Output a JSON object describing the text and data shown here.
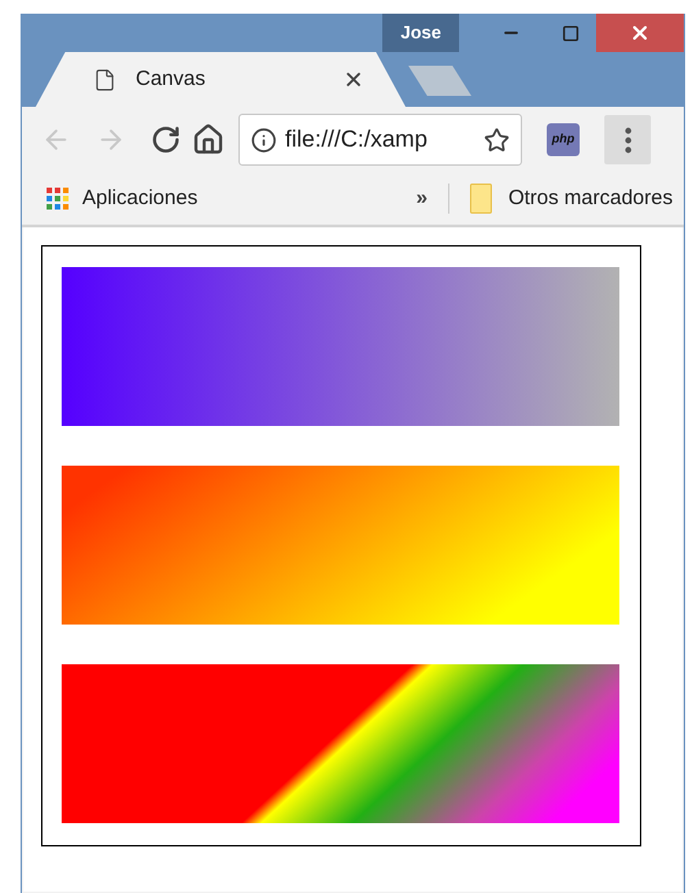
{
  "window": {
    "user": "Jose"
  },
  "tabs": [
    {
      "title": "Canvas",
      "selected": true
    }
  ],
  "toolbar": {
    "back_disabled": true,
    "forward_disabled": true,
    "url": "file:///C:/xamp",
    "extension": "php"
  },
  "bookmarks": {
    "apps": "Aplicaciones",
    "overflow": "»",
    "other": "Otros marcadores"
  }
}
